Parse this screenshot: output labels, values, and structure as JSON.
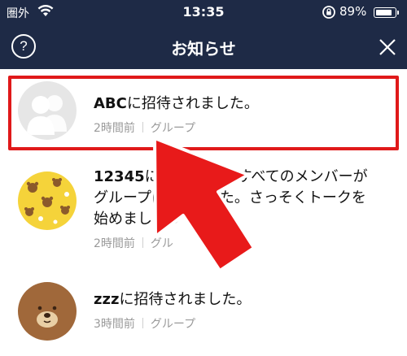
{
  "status_bar": {
    "carrier": "圏外",
    "time": "13:35",
    "battery_percent": "89%",
    "battery_level": 0.89,
    "icons": [
      "wifi-icon",
      "orientation-lock-icon",
      "battery-icon"
    ]
  },
  "nav": {
    "help_label": "?",
    "title": "お知らせ",
    "close_icon": "close-icon"
  },
  "notifications": [
    {
      "name": "ABC",
      "message": "に招待されました。",
      "time": "2時間前",
      "category": "グループ",
      "avatar": "default-group-avatar"
    },
    {
      "name": "12345",
      "message": "に　　　　　たすべてのメンバーがグループに　　　した。さっそくトークを始めましょう",
      "line1": "に",
      "line1b": "たすべてのメンバーが",
      "line2a": "グループに",
      "line2b": "した。さっそくトークを",
      "line3": "始めましょう",
      "time": "2時間前",
      "category": "グル",
      "avatar": "bear-pattern-avatar"
    },
    {
      "name": "zzz",
      "message": "に招待されました。",
      "time": "3時間前",
      "category": "グループ",
      "avatar": "brown-bear-avatar"
    }
  ],
  "colors": {
    "navbar": "#1e2a46",
    "highlight": "#e0191a",
    "meta_text": "#9a9a9a"
  }
}
